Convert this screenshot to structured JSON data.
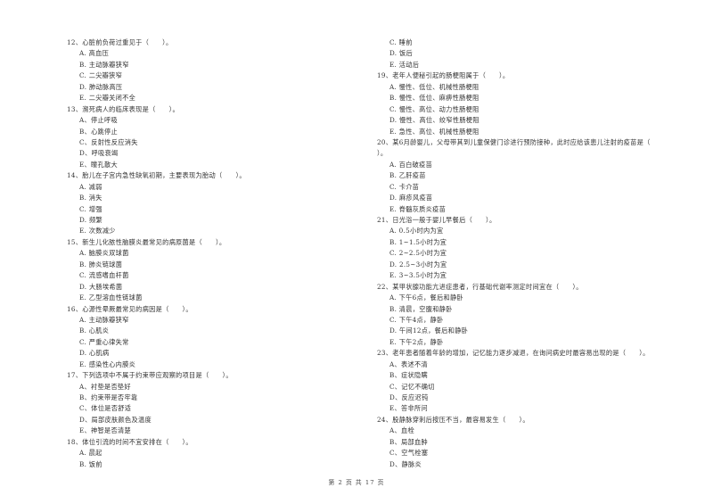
{
  "left_column": [
    {
      "number": "12",
      "stem": "12、心脏前负荷过重见于（　　）。",
      "options": [
        "A. 高血压",
        "B. 主动脉瓣狭窄",
        "C. 二尖瓣狭窄",
        "D. 肺动脉高压",
        "E. 二尖瓣关闭不全"
      ]
    },
    {
      "number": "13",
      "stem": "13、濒死病人的临床表现是（　　）。",
      "options": [
        "A、停止呼吸",
        "B、心跳停止",
        "C、反射性反应消失",
        "D、呼吸衰竭",
        "E、瞳孔散大"
      ]
    },
    {
      "number": "14",
      "stem": "14、胎儿在子宫内急性缺氧初期，主要表现为胎动（　　）。",
      "options": [
        "A. 减弱",
        "B. 消失",
        "C. 增强",
        "D. 频繁",
        "E. 次数减少"
      ]
    },
    {
      "number": "15",
      "stem": "15、新生儿化脓性脑膜炎最常见的病原菌是（　　）。",
      "options": [
        "A. 脑膜炎双球菌",
        "B. 肺炎链球菌",
        "C. 流感嗜血杆菌",
        "D. 大肠埃希菌",
        "E. 乙型溶血性链球菌"
      ]
    },
    {
      "number": "16",
      "stem": "16、心源性晕厥最常见的病因是（　　）。",
      "options": [
        "A. 主动脉瓣狭窄",
        "B. 心肌炎",
        "C. 严重心律失常",
        "D. 心肌病",
        "E. 感染性心内膜炎"
      ]
    },
    {
      "number": "17",
      "stem": "17、下列选项中不属于约束带应观察的项目是（　　）。",
      "options": [
        "A、衬垫是否垫好",
        "B、约束带是否牢靠",
        "C、体位是否舒适",
        "D、局部皮肤颜色及温度",
        "E、神智是否清楚"
      ]
    },
    {
      "number": "18",
      "stem": "18、体位引流的时间不宜安排在（　　）。",
      "options": [
        "A. 晨起",
        "B. 饭前"
      ]
    }
  ],
  "right_column_continued_options": [
    "C. 睡前",
    "D. 饭后",
    "E. 活动后"
  ],
  "right_column": [
    {
      "number": "19",
      "stem": "19、老年人便秘引起的肠梗阻属于（　　）。",
      "options": [
        "A. 慢性、低位、机械性肠梗阻",
        "B. 慢性、低位、麻痹性肠梗阻",
        "C. 慢性、高位、动力性肠梗阻",
        "D. 慢性、高位、绞窄性肠梗阻",
        "E. 急性、高位、机械性肠梗阻"
      ]
    },
    {
      "number": "20",
      "stem": "20、某6月龄婴儿，父母带其到儿童保健门诊进行预防接种，此时应给该患儿注射的疫苗是（",
      "stem_cont": "）。",
      "options": [
        "A. 百白破疫苗",
        "B. 乙肝疫苗",
        "C. 卡介苗",
        "D. 麻疹风疫苗",
        "E. 脊髓灰质炎疫苗"
      ]
    },
    {
      "number": "21",
      "stem": "21、日光浴一般于婴儿早餐后（　　）。",
      "options": [
        "A. 0.5小时内为宜",
        "B. 1~1.5小时为宜",
        "C. 2~2.5小时为宜",
        "D. 2.5~3小时为宜",
        "E. 3~3.5小时为宜"
      ]
    },
    {
      "number": "22",
      "stem": "22、某甲状腺功能亢进症患者，行基础代谢率测定时间宜在（　　）。",
      "options": [
        "A. 下午6点，餐后和静卧",
        "B. 清晨，空腹和静卧",
        "C. 下午4点，静卧",
        "D. 午间12点，餐后和静卧",
        "E. 下午2点，静卧"
      ]
    },
    {
      "number": "23",
      "stem": "23、老年患者随着年龄的增加，记忆能力逐步减退，在询问病史时最容易出现的是（　　）。",
      "options": [
        "A、表述不清",
        "B、症状隐瞒",
        "C、记忆不确切",
        "D、反应迟钝",
        "E、答非所问"
      ]
    },
    {
      "number": "24",
      "stem": "24、股静脉穿刺后按压不当，最容易发生（　　）。",
      "options": [
        "A、血栓",
        "B、局部血肿",
        "C、空气栓塞",
        "D、静脉炎"
      ]
    }
  ],
  "footer": {
    "page_label": "第 2 页 共 17 页"
  }
}
